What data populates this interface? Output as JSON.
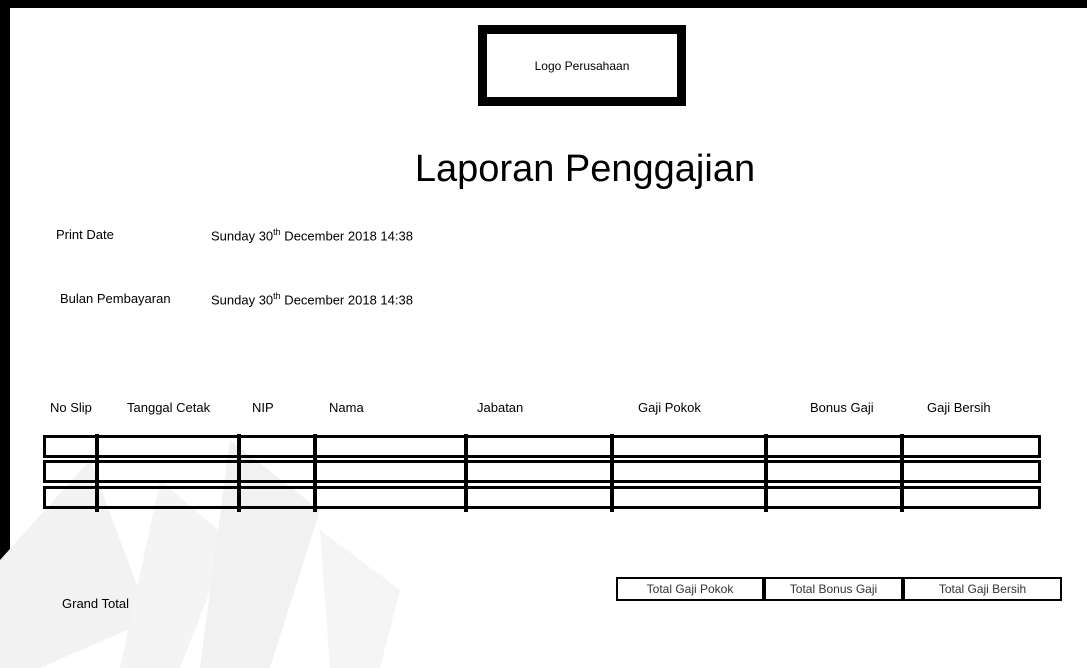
{
  "logo": {
    "text": "Logo Perusahaan"
  },
  "title": "Laporan Penggajian",
  "info": {
    "print_date_label": "Print Date",
    "print_date_value": {
      "prefix": "Sunday 30",
      "sup": "th",
      "suffix": " December 2018 14:38"
    },
    "bulan_label": "Bulan Pembayaran",
    "bulan_value": {
      "prefix": "Sunday 30",
      "sup": "th",
      "suffix": " December 2018 14:38"
    }
  },
  "table": {
    "columns": [
      "No Slip",
      "Tanggal Cetak",
      "NIP",
      "Nama",
      "Jabatan",
      "Gaji Pokok",
      "Bonus Gaji",
      "Gaji Bersih"
    ],
    "empty_rows": 3
  },
  "totals": {
    "grand_total_label": "Grand Total",
    "boxes": [
      "Total Gaji Pokok",
      "Total Bonus Gaji",
      "Total Gaji Bersih"
    ]
  }
}
